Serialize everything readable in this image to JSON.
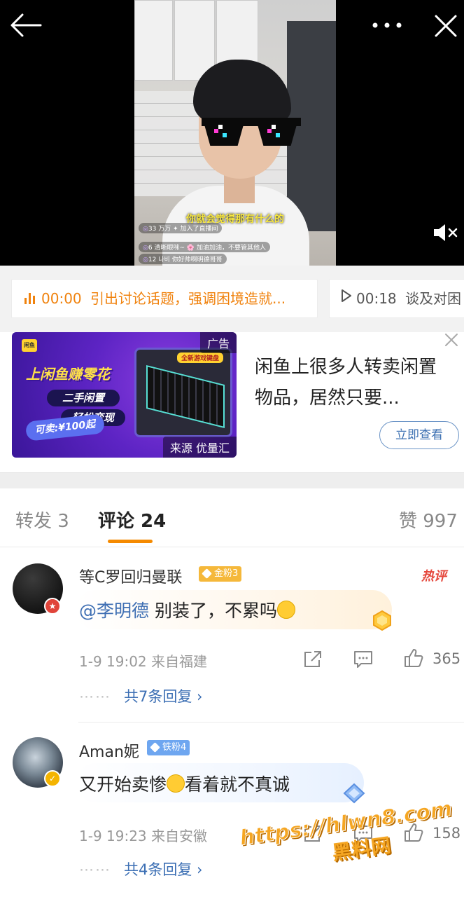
{
  "video": {
    "subtitle": "你就会觉得那有什么的",
    "live_lines": [
      {
        "badge": "33",
        "text": "万万 ✦ 加入了直播间"
      },
      {
        "badge": "6",
        "text": "清晰眼咪~ 🌸 加油加油，不要管其他人"
      },
      {
        "badge": "12",
        "text": "나비 你好帅啊明德哥哥"
      }
    ],
    "icons": {
      "back": "back-arrow-icon",
      "more": "more-dots-icon",
      "close": "close-icon",
      "mute": "mute-speaker-icon"
    }
  },
  "chapters": [
    {
      "time": "00:00",
      "text": "引出讨论话题，强调困境造就..."
    },
    {
      "time": "00:18",
      "text": "谈及对困"
    }
  ],
  "ad": {
    "tag": "广告",
    "source": "来源 优量汇",
    "image_headline": "上闲鱼赚零花",
    "image_pill1": "二手闲置",
    "image_pill2": "轻松变现",
    "image_price": "可卖:¥100起",
    "image_badge": "全新游戏键盘",
    "logo": "闲鱼",
    "title": "闲鱼上很多人转卖闲置物品，居然只要...",
    "button": "立即查看"
  },
  "tabs": {
    "repost": "转发 3",
    "comment": "评论 24",
    "like": "赞 997"
  },
  "comments": [
    {
      "username": "等C罗回归曼联",
      "badge": "金粉3",
      "hot": "热评",
      "mention": "@李明德",
      "text": " 别装了，不累吗",
      "meta": "1-9 19:02 来自福建",
      "likes": "365",
      "replies_dots": "⋯⋯",
      "replies": "共7条回复 ›"
    },
    {
      "username": "Aman妮",
      "badge": "铁粉4",
      "mention": "",
      "text_before": "又开始卖惨",
      "text_after": "看着就不真诚",
      "meta": "1-9 19:23 来自安徽",
      "likes": "158",
      "replies_dots": "⋯⋯",
      "replies": "共4条回复 ›"
    }
  ],
  "watermark": {
    "url": "https://hlwn8.com",
    "name": "黑料网"
  },
  "colors": {
    "accent": "#f58a00",
    "link": "#3c6fb4",
    "gold_badge": "#f5b83a",
    "iron_badge": "#6ea6f0"
  }
}
